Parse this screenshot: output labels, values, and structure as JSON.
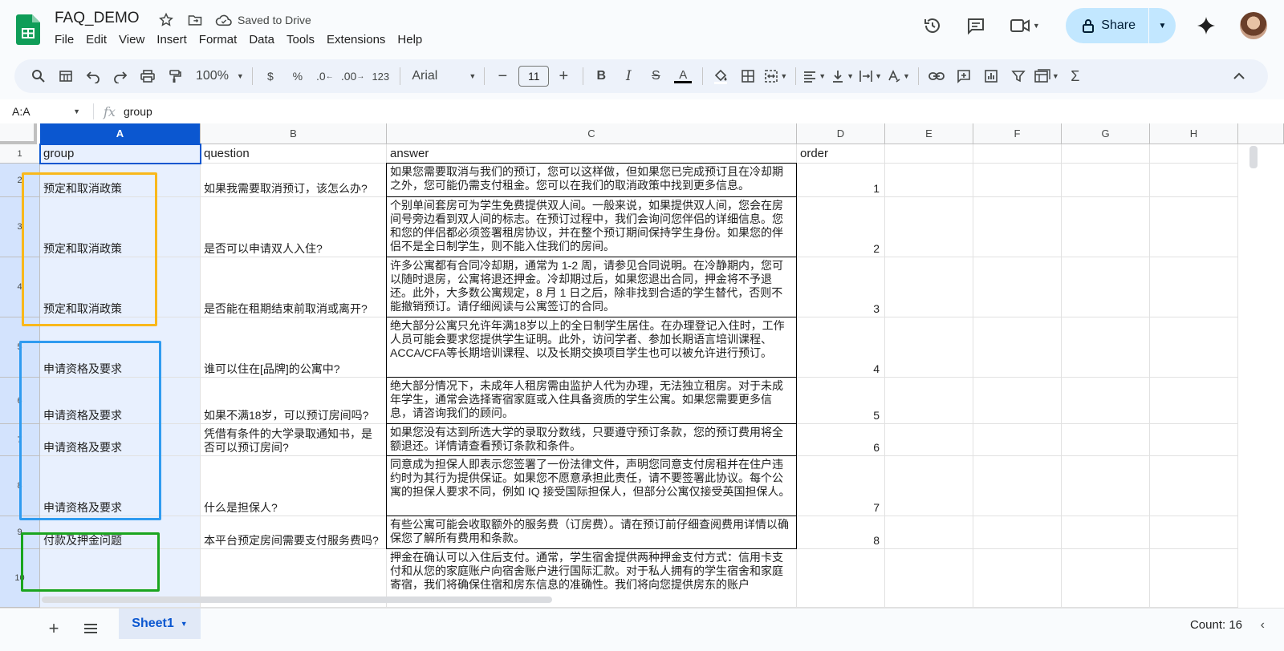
{
  "doc": {
    "title": "FAQ_DEMO",
    "saved_status": "Saved to Drive",
    "icons": [
      "star-icon",
      "move-folder-icon",
      "cloud-done-icon"
    ]
  },
  "menu": [
    "File",
    "Edit",
    "View",
    "Insert",
    "Format",
    "Data",
    "Tools",
    "Extensions",
    "Help"
  ],
  "header_right": {
    "share_label": "Share",
    "icons": [
      "version-history-icon",
      "comments-icon",
      "meet-icon",
      "gemini-icon",
      "avatar"
    ]
  },
  "toolbar": {
    "zoom": "100%",
    "currency": "$",
    "percent": "%",
    "dec_decrease": ".0",
    "dec_increase": ".00",
    "more_formats": "123",
    "font": "Arial",
    "font_size": "11"
  },
  "formula_bar": {
    "name_box": "A:A",
    "fx": "fx",
    "value": "group"
  },
  "columns": [
    "A",
    "B",
    "C",
    "D",
    "E",
    "F",
    "G",
    "H"
  ],
  "rows": [
    {
      "num": "1",
      "group": "group",
      "question": "question",
      "answer": "answer",
      "order": "order"
    },
    {
      "num": "2",
      "group": "预定和取消政策",
      "question": "如果我需要取消预订，该怎么办?",
      "answer": "如果您需要取消与我们的预订，您可以这样做，但如果您已完成预订且在冷却期之外，您可能仍需支付租金。您可以在我们的取消政策中找到更多信息。",
      "order": "1"
    },
    {
      "num": "3",
      "group": "预定和取消政策",
      "question": "是否可以申请双人入住?",
      "answer": "个别单间套房可为学生免费提供双人间。一般来说，如果提供双人间，您会在房间号旁边看到双人间的标志。在预订过程中，我们会询问您伴侣的详细信息。您和您的伴侣都必须签署租房协议，并在整个预订期间保持学生身份。如果您的伴侣不是全日制学生，则不能入住我们的房间。",
      "order": "2"
    },
    {
      "num": "4",
      "group": "预定和取消政策",
      "question": "是否能在租期结束前取消或离开?",
      "answer": "许多公寓都有合同冷却期，通常为 1-2 周，请参见合同说明。在冷静期内，您可以随时退房，公寓将退还押金。冷却期过后，如果您退出合同，押金将不予退还。此外，大多数公寓规定，8 月 1 日之后，除非找到合适的学生替代，否则不能撤销预订。请仔细阅读与公寓签订的合同。",
      "order": "3"
    },
    {
      "num": "5",
      "group": "申请资格及要求",
      "question": "谁可以住在[品牌]的公寓中?",
      "answer": "绝大部分公寓只允许年满18岁以上的全日制学生居住。在办理登记入住时，工作人员可能会要求您提供学生证明。此外，访问学者、参加长期语言培训课程、ACCA/CFA等长期培训课程、以及长期交换项目学生也可以被允许进行预订。",
      "order": "4"
    },
    {
      "num": "6",
      "group": "申请资格及要求",
      "question": "如果不满18岁，可以预订房间吗?",
      "answer": "绝大部分情况下，未成年人租房需由监护人代为办理，无法独立租房。对于未成年学生，通常会选择寄宿家庭或入住具备资质的学生公寓。如果您需要更多信息，请咨询我们的顾问。",
      "order": "5"
    },
    {
      "num": "7",
      "group": "申请资格及要求",
      "question": "凭借有条件的大学录取通知书，是否可以预订房间?",
      "answer": "如果您没有达到所选大学的录取分数线，只要遵守预订条款，您的预订费用将全额退还。详情请查看预订条款和条件。",
      "order": "6"
    },
    {
      "num": "8",
      "group": "申请资格及要求",
      "question": "什么是担保人?",
      "answer": "同意成为担保人即表示您签署了一份法律文件，声明您同意支付房租并在住户违约时为其行为提供保证。如果您不愿意承担此责任，请不要签署此协议。每个公寓的担保人要求不同，例如 IQ 接受国际担保人，但部分公寓仅接受英国担保人。",
      "order": "7"
    },
    {
      "num": "9",
      "group": "付款及押金问题",
      "question": "本平台预定房间需要支付服务费吗?",
      "answer": "有些公寓可能会收取额外的服务费（订房费）。请在预订前仔细查阅费用详情以确保您了解所有费用和条款。",
      "order": "8"
    },
    {
      "num": "10",
      "group": "",
      "question": "",
      "answer": "押金在确认可以入住后支付。通常，学生宿舍提供两种押金支付方式：信用卡支付和从您的家庭账户向宿舍账户进行国际汇款。对于私人拥有的学生宿舍和家庭寄宿，我们将确保住宿和房东信息的准确性。我们将向您提供房东的账户",
      "order": ""
    }
  ],
  "highlights": [
    {
      "name": "highlight-booking-group",
      "color": "#f9b81b"
    },
    {
      "name": "highlight-eligibility-group",
      "color": "#2f9bf0"
    },
    {
      "name": "highlight-payment-group",
      "color": "#1aa51e"
    }
  ],
  "bottom": {
    "sheet_name": "Sheet1",
    "count": "Count: 16"
  }
}
